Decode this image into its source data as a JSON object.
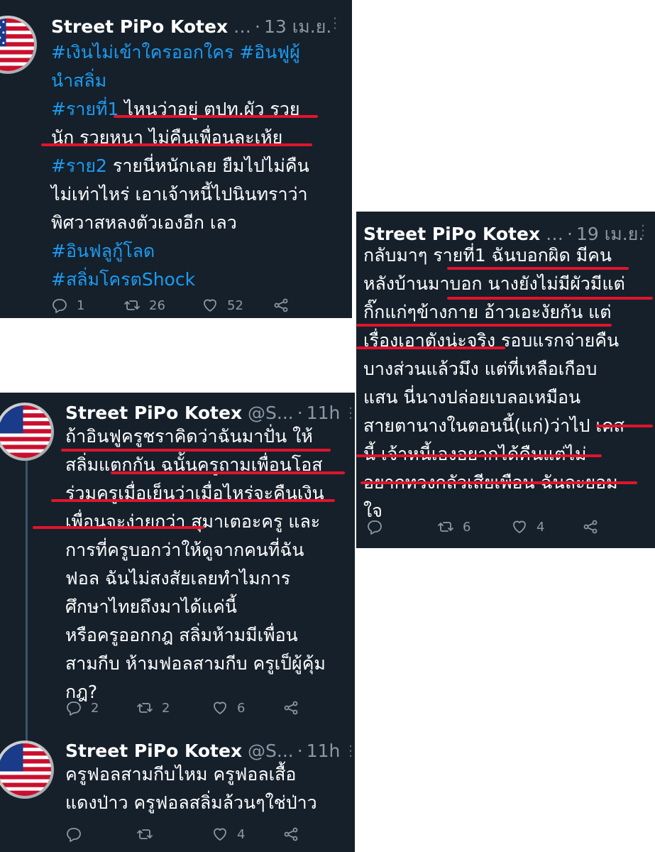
{
  "colors": {
    "card_bg": "#15202b",
    "text": "#ffffff",
    "muted": "#8b98a5",
    "hashtag": "#1d9bf0",
    "underline": "#e0142c"
  },
  "tweets": [
    {
      "author": "Street PiPo Kotex",
      "handle": "…",
      "time": "13 เม.ย.",
      "lines": [
        [
          {
            "t": "#เงินไม่เข้าใครออกใคร #อินฟูผู้",
            "h": true
          }
        ],
        [
          {
            "t": "นำสลิ่ม",
            "h": true
          }
        ],
        [
          {
            "t": "#รายที่1",
            "h": true
          },
          {
            "t": " ไหนว่าอยู่ ตปท.ผัว รวย"
          }
        ],
        [
          {
            "t": "นัก รวยหนา ไม่คืนเพื่อนละเห้ย"
          }
        ],
        [
          {
            "t": "#ราย2",
            "h": true
          },
          {
            "t": " รายนี่หนักเลย ยืมไปไม่คืน"
          }
        ],
        [
          {
            "t": "ไม่เท่าไหร่ เอาเจ้าหนี้ไปนินทราว่า"
          }
        ],
        [
          {
            "t": "พิศวาสหลงตัวเองอีก เลว"
          }
        ],
        [
          {
            "t": "#อินฟลูกู้โลด",
            "h": true
          }
        ],
        [
          {
            "t": "#สลิ่มโครตShock",
            "h": true
          }
        ]
      ],
      "replies": "1",
      "retweets": "26",
      "likes": "52",
      "share_icon": "share-icon"
    },
    {
      "author": "Street PiPo Kotex",
      "handle": "…",
      "time": "19 เม.ย.",
      "lines": [
        [
          {
            "t": "กลับมาๆ  รายที่1 ฉันบอกผิด มีคน"
          }
        ],
        [
          {
            "t": "หลังบ้านมาบอก นางยังไม่มีผัวมีแต่"
          }
        ],
        [
          {
            "t": "กิ๊กแก่ๆข้างกาย อ้าวเอะงัยกัน แต่"
          }
        ],
        [
          {
            "t": "เรื่องเอาตังน่ะจริง รอบแรกจ่ายคืน"
          }
        ],
        [
          {
            "t": "บางส่วนแล้วมึง แต่ที่เหลือเกือบ"
          }
        ],
        [
          {
            "t": "แสน นี่นางปล่อยเบลอเหมือน"
          }
        ],
        [
          {
            "t": "สายตานางในตอนนี้(แก่)ว่าไป เคส"
          }
        ],
        [
          {
            "t": "นี้ เจ้าหนี้เองอยากได้คืนแต่ไม่"
          }
        ],
        [
          {
            "t": "อยากทวงกลัวเสียเพือน ฉันละยอม"
          }
        ],
        [
          {
            "t": "ใจ"
          }
        ]
      ],
      "replies": "",
      "retweets": "6",
      "likes": "4",
      "share_icon": "share-icon"
    },
    {
      "author": "Street PiPo Kotex",
      "handle": "@S...",
      "time": "11h",
      "lines": [
        [
          {
            "t": "ถ้าอินฟูครูชราคิดว่าฉันมาปั่น ให้"
          }
        ],
        [
          {
            "t": "สลิ่มแตกกัน ฉนั้นครูถามเพื่อนโอส"
          }
        ],
        [
          {
            "t": "ร่วมครูเมื่อเย็นว่าเมื่อไหร่จะคืนเงิน"
          }
        ],
        [
          {
            "t": "เพื่อนจะง่ายกว่า สุมาเตอะครู และ"
          }
        ],
        [
          {
            "t": "การที่ครูบอกว่าให้ดูจากคนที่ฉัน"
          }
        ],
        [
          {
            "t": "ฟอล ฉันไม่สงสัยเลยทำไมการ"
          }
        ],
        [
          {
            "t": "ศึกษาไทยถึงมาได้แค่นี้"
          }
        ],
        [
          {
            "t": "หรือครูออกกฎ สลิ่มห้ามมีเพื่อน"
          }
        ],
        [
          {
            "t": "สามกีบ ห้ามฟอลสามกีบ ครูเป็ผู้คุ้ม"
          }
        ],
        [
          {
            "t": "กฎ?"
          }
        ]
      ],
      "replies": "2",
      "retweets": "2",
      "likes": "6",
      "share_icon": "share-icon"
    },
    {
      "author": "Street PiPo Kotex",
      "handle": "@S...",
      "time": "11h",
      "lines": [
        [
          {
            "t": "ครูฟอลสามกีบไหม ครูฟอลเสื้อ"
          }
        ],
        [
          {
            "t": "แดงป่าว ครูฟอลสลิ่มล้วนๆใช่ป่าว"
          }
        ]
      ],
      "replies": "",
      "retweets": "",
      "likes": "4",
      "share_icon": "share-icon"
    }
  ]
}
